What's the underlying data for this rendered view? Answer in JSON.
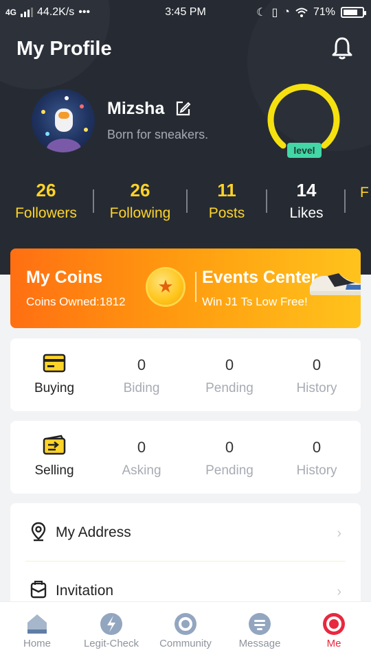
{
  "status_bar": {
    "network": "4G",
    "speed": "44.2K/s",
    "time": "3:45 PM",
    "battery": "71%"
  },
  "header": {
    "title": "My Profile"
  },
  "profile": {
    "name": "Mizsha",
    "bio": "Born for sneakers.",
    "level_label": "level"
  },
  "stats": [
    {
      "value": "26",
      "label": "Followers"
    },
    {
      "value": "26",
      "label": "Following"
    },
    {
      "value": "11",
      "label": "Posts"
    },
    {
      "value": "14",
      "label": "Likes"
    },
    {
      "value": "",
      "label": "F"
    }
  ],
  "promo": {
    "coins_title": "My Coins",
    "coins_sub": "Coins Owned:1812",
    "events_title": "Events Center",
    "events_sub": "Win J1 Ts Low Free!"
  },
  "buying": {
    "label": "Buying",
    "items": [
      {
        "value": "0",
        "label": "Biding"
      },
      {
        "value": "0",
        "label": "Pending"
      },
      {
        "value": "0",
        "label": "History"
      }
    ]
  },
  "selling": {
    "label": "Selling",
    "items": [
      {
        "value": "0",
        "label": "Asking"
      },
      {
        "value": "0",
        "label": "Pending"
      },
      {
        "value": "0",
        "label": "History"
      }
    ]
  },
  "menu": {
    "address": "My Address",
    "invitation": "Invitation"
  },
  "tabs": [
    {
      "label": "Home",
      "icon": "home-icon"
    },
    {
      "label": "Legit-Check",
      "icon": "legit-check-icon"
    },
    {
      "label": "Community",
      "icon": "community-icon"
    },
    {
      "label": "Message",
      "icon": "message-icon"
    },
    {
      "label": "Me",
      "icon": "me-icon"
    }
  ],
  "colors": {
    "hero_bg": "#262b33",
    "accent_yellow": "#ffd428",
    "level_green": "#43d6a6",
    "active_tab": "#e8283f"
  }
}
